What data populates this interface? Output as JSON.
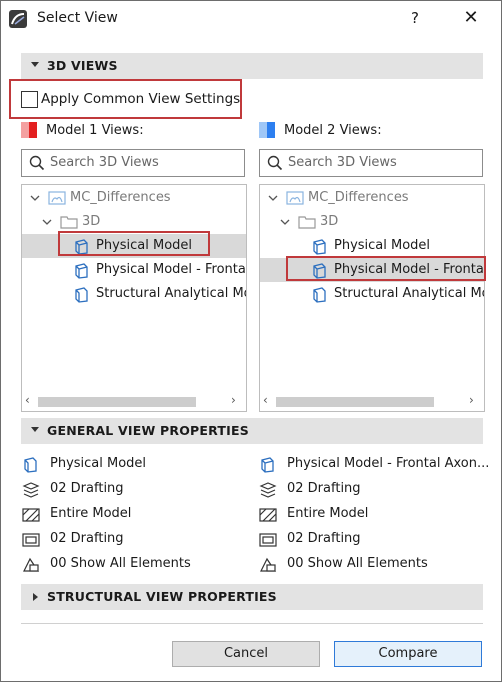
{
  "window": {
    "title": "Select View",
    "help": "?",
    "close": "✕"
  },
  "section_3d": {
    "label": "3D VIEWS"
  },
  "common_settings": {
    "label": "Apply Common View Settings",
    "checked": false
  },
  "model1": {
    "label": "Model 1 Views:",
    "swatch_colors": [
      "#f4a0a0",
      "#e32020"
    ],
    "search_placeholder": "Search 3D Views",
    "tree": [
      {
        "text": "MC_Differences"
      },
      {
        "text": "3D"
      },
      {
        "text": "Physical Model"
      },
      {
        "text": "Physical Model - Frontal"
      },
      {
        "text": "Structural Analytical Mod"
      }
    ],
    "selected": "Physical Model"
  },
  "model2": {
    "label": "Model 2 Views:",
    "swatch_colors": [
      "#9fc7f7",
      "#2d7ff0"
    ],
    "search_placeholder": "Search 3D Views",
    "tree": [
      {
        "text": "MC_Differences"
      },
      {
        "text": "3D"
      },
      {
        "text": "Physical Model"
      },
      {
        "text": "Physical Model - Frontal"
      },
      {
        "text": "Structural Analytical Mod"
      }
    ],
    "selected": "Physical Model - Frontal"
  },
  "section_general": {
    "label": "GENERAL VIEW PROPERTIES"
  },
  "general_props": {
    "left": [
      "Physical Model",
      "02 Drafting",
      "Entire Model",
      "02 Drafting",
      "00 Show All Elements"
    ],
    "right": [
      "Physical Model - Frontal Axon...",
      "02 Drafting",
      "Entire Model",
      "02 Drafting",
      "00 Show All Elements"
    ]
  },
  "section_structural": {
    "label": "STRUCTURAL VIEW PROPERTIES"
  },
  "buttons": {
    "cancel": "Cancel",
    "compare": "Compare"
  },
  "colors": {
    "highlight": "#c0393b",
    "accent": "#2f7ad8",
    "icon_blue": "#2c6fbf"
  }
}
